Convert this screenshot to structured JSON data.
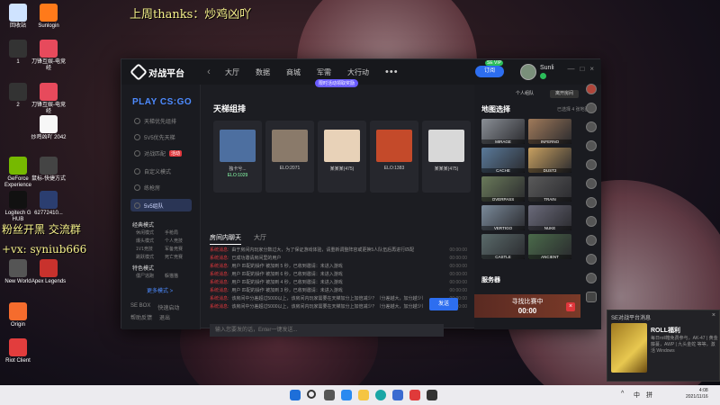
{
  "overlay": {
    "top_text": "上周thanks：炒鸡凶吖",
    "left_text1": "粉丝开黑  交流群",
    "left_text2": "+vx: syniub666"
  },
  "desktop_icons": [
    {
      "label": "回收站",
      "color": "#cfe3ff"
    },
    {
      "label": "Sunlogin",
      "color": "#ff7a1a"
    },
    {
      "label": "1",
      "color": "#333"
    },
    {
      "label": "刀锋互娱-电竞经",
      "color": "#e74a5c"
    },
    {
      "label": "2",
      "color": "#333"
    },
    {
      "label": "刀锋互娱-电竞经",
      "color": "#e74a5c"
    },
    {
      "label": "炒鸡凶吖 2042",
      "color": "#f7f7f7"
    },
    {
      "label": "GeForce Experience",
      "color": "#76b900"
    },
    {
      "label": "鼠标-快捷方式",
      "color": "#444"
    },
    {
      "label": "Logitech G HUB",
      "color": "#111"
    },
    {
      "label": "62772410...",
      "color": "#2b3e70"
    },
    {
      "label": "New World",
      "color": "#555"
    },
    {
      "label": "Apex Legends",
      "color": "#c8322d"
    },
    {
      "label": "Origin",
      "color": "#f56c2d"
    },
    {
      "label": "Riot Client",
      "color": "#e23d3d"
    }
  ],
  "app": {
    "logo": "对战平台",
    "nav_tabs": [
      "大厅",
      "数据",
      "商城",
      "军需",
      "大行动"
    ],
    "more": "•••",
    "promo_badge": "限时活动领取奖励",
    "vip_button": "订阅",
    "vip_tag": "SE VIP",
    "username": "Sunli",
    "window_controls": [
      "—",
      "□",
      "×"
    ]
  },
  "sidebar": {
    "game_title": "PLAY CS:GO",
    "items": [
      {
        "label": "天梯优先组排",
        "tag": ""
      },
      {
        "label": "5V5优先天梯",
        "tag": ""
      },
      {
        "label": "对战匹配",
        "tag": "活动"
      },
      {
        "label": "自定义模式",
        "tag": ""
      },
      {
        "label": "练枪房",
        "tag": ""
      },
      {
        "label": "5v5组队",
        "tag": ""
      }
    ],
    "section1": {
      "title": "经典模式",
      "items": [
        "休闲模式",
        "手枪局",
        "爆头模式",
        "个人竞技",
        "1V1竞技",
        "军备竞赛",
        "跳跃模式",
        "死亡竞赛"
      ]
    },
    "section2": {
      "title": "特色模式",
      "items": [
        "僵尸逃跑",
        "躲猫猫"
      ]
    },
    "more_link": "更多模式 >",
    "footer": [
      "SE BOX",
      "快速启动",
      "帮助反馈",
      "退出"
    ]
  },
  "center": {
    "section_title": "天梯组排",
    "players": [
      {
        "name": "独卡兮...",
        "elo": "ELO:1029",
        "color": "#4d6fa0"
      },
      {
        "name": "ELO:2071",
        "elo": "",
        "color": "#8a7a6a"
      },
      {
        "name": "某某某(475)",
        "elo": "",
        "color": "#e8d2b8"
      },
      {
        "name": "ELO:1383",
        "elo": "",
        "color": "#c44a2a"
      },
      {
        "name": "某某某(475)",
        "elo": "",
        "color": "#d8d8d8"
      }
    ],
    "chat_tabs": [
      "房间内聊天",
      "大厅"
    ],
    "chat_lines": [
      {
        "who": "系统消息:",
        "msg": "由于房间内玩家分数过大，为了保证游戏体验，请重新调整阵容或更换5人队伍后再进行匹配",
        "time": "00:00:00"
      },
      {
        "who": "系统消息:",
        "msg": "已成功邀请房间里的用户",
        "time": "00:00:00"
      },
      {
        "who": "系统消息:",
        "msg": "用户 匹配的操作 被加到 5 秒，已收到邀请：未进入游戏",
        "time": "00:00:00"
      },
      {
        "who": "系统消息:",
        "msg": "用户 匹配的操作 被加到 6 秒，已收到邀请：未进入游戏",
        "time": "00:00:00"
      },
      {
        "who": "系统消息:",
        "msg": "用户 匹配的操作 被加到 4 秒，已收到邀请：未进入游戏",
        "time": "00:00:00"
      },
      {
        "who": "系统消息:",
        "msg": "用户 匹配的操作 被加到 3 秒，已收到邀请：未进入游戏",
        "time": "00:00:00"
      },
      {
        "who": "系统消息:",
        "msg": "该房间中分差超过5000以上，该房间内玩家需要在天梯加分上加倍减少？（分差越大，加分越少）",
        "time": "00:00:00"
      },
      {
        "who": "系统消息:",
        "msg": "该房间中分差超过5000以上，该房间内玩家需要在天梯加分上加倍减少？（分差越大，加分越少）",
        "time": "00:00:00"
      }
    ],
    "chat_placeholder": "输入您要发的话，Enter一键发送...",
    "send_label": "发送"
  },
  "right": {
    "sub_buttons": [
      "个人组队",
      "离开房间"
    ],
    "map_title": "地图选择",
    "map_meta": "已选择 4 张地图",
    "maps": [
      {
        "name": "MIRAGE",
        "color": "#8a8f96"
      },
      {
        "name": "INFERNO",
        "color": "#a07a5a"
      },
      {
        "name": "CACHE",
        "color": "#5a7a9a"
      },
      {
        "name": "DUST2",
        "color": "#c8a060"
      },
      {
        "name": "OVERPASS",
        "color": "#6a7a5a"
      },
      {
        "name": "TRAIN",
        "color": "#5a5a5a"
      },
      {
        "name": "VERTIGO",
        "color": "#7a8a9a"
      },
      {
        "name": "NUKE",
        "color": "#6a6a7a"
      },
      {
        "name": "CASTLE",
        "color": "#5a6a6a"
      },
      {
        "name": "ANCIENT",
        "color": "#4a6a4a"
      }
    ],
    "server_title": "服务器",
    "match_text": "寻找比赛中",
    "match_time": "00:00",
    "match_cancel": "×"
  },
  "notification": {
    "head": "SE对战平台消息",
    "close": "×",
    "title": "ROLL福利",
    "body": "每日roll箱免费参与，AK-47 | 黄金藤蔓，AWP | 九头金蛇 等等，激活 Windows"
  },
  "taskbar": {
    "tray": [
      "^",
      "中",
      "拼"
    ],
    "time": "4:08",
    "date": "2021/11/16"
  }
}
